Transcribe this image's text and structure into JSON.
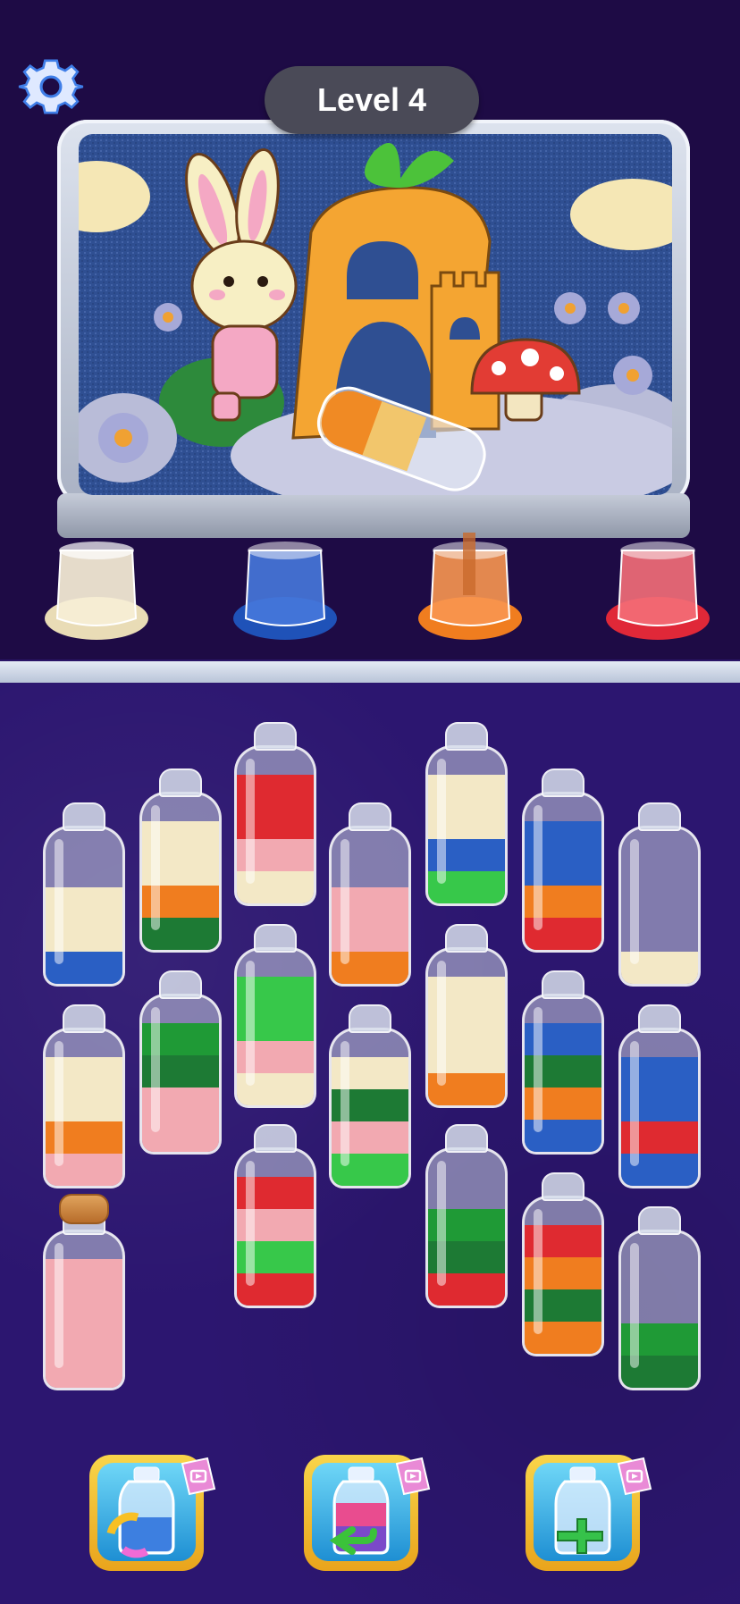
{
  "header": {
    "level_label": "Level 4",
    "settings_icon": "gear-icon"
  },
  "picture": {
    "description_icons": [
      "bunny",
      "carrot-house",
      "castle",
      "mushroom",
      "flowers",
      "clouds"
    ],
    "pouring_bottle_color": "#f08a24"
  },
  "buckets": [
    {
      "name": "cream",
      "color": "#f0e6c8"
    },
    {
      "name": "blue",
      "color": "#2f62c8"
    },
    {
      "name": "orange",
      "color": "#f07d1f"
    },
    {
      "name": "red",
      "color": "#e8404d"
    }
  ],
  "colors": {
    "red": "#df2a30",
    "pink": "#f2a9b1",
    "cream": "#f3e8c6",
    "blue": "#2a5fc4",
    "green": "#1f9a36",
    "orange": "#f07d1f",
    "darkgreen": "#1d7a34",
    "lightgreen": "#37c84a"
  },
  "bottles": [
    {
      "id": 1,
      "layers": [
        "blue",
        "cream",
        "cream"
      ]
    },
    {
      "id": 2,
      "layers": [
        "darkgreen",
        "orange",
        "cream",
        "cream"
      ]
    },
    {
      "id": 3,
      "layers": [
        "cream",
        "pink",
        "red",
        "red"
      ]
    },
    {
      "id": 4,
      "layers": [
        "orange",
        "pink",
        "pink"
      ]
    },
    {
      "id": 5,
      "layers": [
        "lightgreen",
        "blue",
        "cream",
        "cream"
      ]
    },
    {
      "id": 6,
      "layers": [
        "red",
        "orange",
        "blue",
        "blue"
      ]
    },
    {
      "id": 7,
      "layers": [
        "cream"
      ]
    },
    {
      "id": 8,
      "layers": [
        "pink",
        "orange",
        "cream",
        "cream"
      ]
    },
    {
      "id": 9,
      "layers": [
        "pink",
        "pink",
        "darkgreen",
        "green"
      ]
    },
    {
      "id": 10,
      "layers": [
        "cream",
        "pink",
        "lightgreen",
        "lightgreen"
      ]
    },
    {
      "id": 11,
      "layers": [
        "lightgreen",
        "pink",
        "darkgreen",
        "cream"
      ]
    },
    {
      "id": 12,
      "layers": [
        "orange",
        "cream",
        "cream",
        "cream"
      ]
    },
    {
      "id": 13,
      "layers": [
        "blue",
        "orange",
        "darkgreen",
        "blue"
      ]
    },
    {
      "id": 14,
      "layers": [
        "blue",
        "red",
        "blue",
        "blue"
      ]
    },
    {
      "id": 15,
      "layers": [
        "pink",
        "pink",
        "pink",
        "pink"
      ],
      "corked": true
    },
    {
      "id": 16,
      "layers": [
        "red",
        "lightgreen",
        "pink",
        "red"
      ]
    },
    {
      "id": 17,
      "layers": [
        "red",
        "darkgreen",
        "green"
      ]
    },
    {
      "id": 18,
      "layers": [
        "orange",
        "darkgreen",
        "orange",
        "red"
      ]
    },
    {
      "id": 19,
      "layers": [
        "darkgreen",
        "green"
      ]
    }
  ],
  "tools": [
    {
      "name": "shuffle",
      "icon": "shuffle-bottle-icon",
      "badge": "video-ad-icon"
    },
    {
      "name": "undo",
      "icon": "undo-bottle-icon",
      "badge": "video-ad-icon"
    },
    {
      "name": "add-bottle",
      "icon": "add-bottle-icon",
      "badge": "video-ad-icon"
    }
  ]
}
